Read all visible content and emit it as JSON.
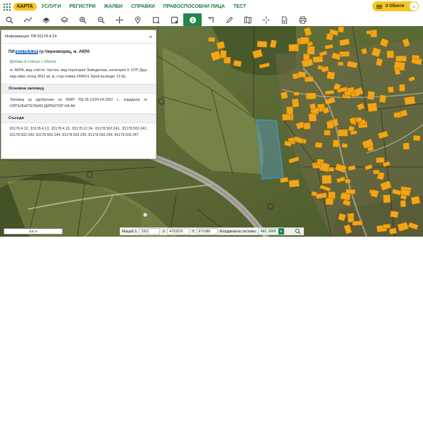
{
  "nav": {
    "items": [
      {
        "label": "КАРТА",
        "active": true
      },
      {
        "label": "УСЛУГИ"
      },
      {
        "label": "РЕГИСТРИ"
      },
      {
        "label": "ЖАЛБИ"
      },
      {
        "label": "СПРАВКИ"
      },
      {
        "label": "ПРАВОСПОСОБНИ ЛИЦА"
      },
      {
        "label": "ТЕСТ"
      }
    ],
    "objects_label": "0 Обекти"
  },
  "toolbar": {
    "tools": [
      "search-icon",
      "measure-icon",
      "layers-icon",
      "layers-stack-icon",
      "zoom-in-icon",
      "zoom-out-icon",
      "pan-icon",
      "marker-icon",
      "select-rectangle-icon",
      "select-area-icon",
      "info-icon",
      "corner-icon",
      "edit-icon",
      "book-map-icon",
      "crosshair-icon",
      "document-icon",
      "print-icon"
    ],
    "active_tool": "info-icon"
  },
  "info_panel": {
    "header": "Информация: ПИ 81178.4.24",
    "parcel_id": "81178.4.24",
    "parcel_location": "гр.Черноморец, м. АКРА",
    "parcel_prefix": "ПИ",
    "add_to_list": "Добави в списък с обекти",
    "description": "м. АКРА, вид собств. Частна, вид територия Земеделска, категория 4, НТП Друг вид нива, площ 3652 кв. м, стар номер 004014, Брой възходи: 13 бр.",
    "order_title": "Основна заповед",
    "order_text": "Заповед за одобрение на КККР РД-18-12/24.04.2007 г., издадена от ИЗПЪЛНИТЕЛНИЯ ДИРЕКТОР НА АК",
    "neighbors_title": "Съседи",
    "neighbors": "81178.4.12, 81178.4.13, 81178.4.15, 81178.12.34, 81178.502.241, 81178.502.242, 81178.502.243, 81178.502.244, 81178.502.245, 81178.502.246, 81178.502.247"
  },
  "map": {
    "scale_bar": "100 m",
    "scale_label": "Мащаб 1:",
    "scale_value": "1921",
    "x_label": "X:",
    "x_value": "4703225",
    "y_label": "Y:",
    "y_value": "675288",
    "coord_system_label": "Координатна система:",
    "coord_system_value": "ККС 2005"
  },
  "colors": {
    "brand_green": "#1f7a3a",
    "accent_yellow": "#f6c41e",
    "building_orange": "#f2a516",
    "parcel_blue": "#3a9ad9"
  }
}
